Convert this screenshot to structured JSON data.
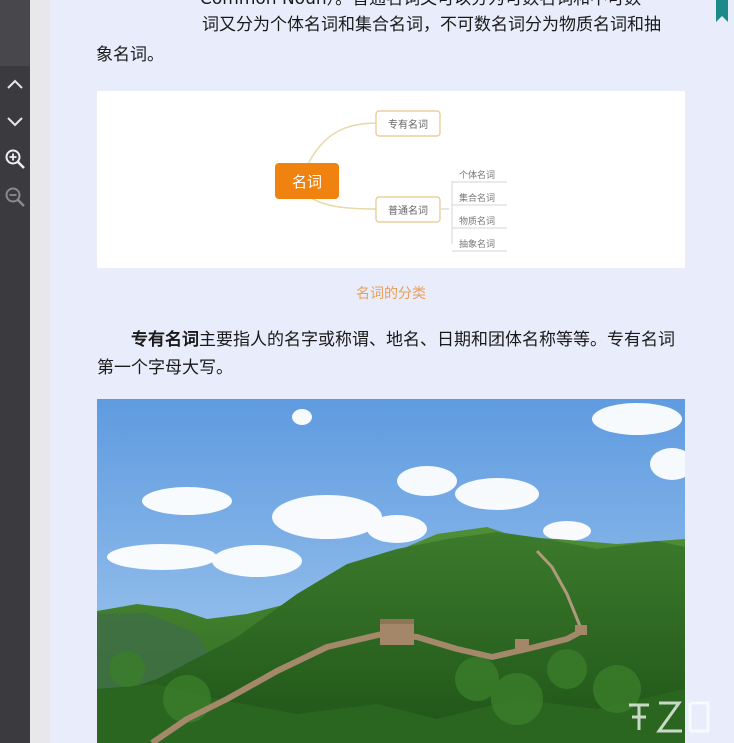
{
  "toolbar": {
    "buttons": [
      {
        "icon": "chevron-up-icon"
      },
      {
        "icon": "chevron-down-icon"
      },
      {
        "icon": "zoom-in-icon"
      },
      {
        "icon": "zoom-out-icon"
      }
    ]
  },
  "article": {
    "cut_line": "Common Noun）。普通名词又可以分为可数名词和不可数",
    "line1": "词又分为个体名词和集合名词，不可数名词分为物质名词和抽",
    "line2": "象名词。",
    "mindmap": {
      "root": "名词",
      "branch1": "专有名词",
      "branch2": "普通名词",
      "leaves": [
        "个体名词",
        "集合名词",
        "物质名词",
        "抽象名词"
      ]
    },
    "caption": "名词的分类",
    "para2_bold": "专有名词",
    "para2_rest": "主要指人的名字或称谓、地名、日期和团体名称等等。专有名词第一个字母大写。"
  },
  "colors": {
    "page_bg": "#e9ecfb",
    "toolbar_bg": "#3a3a3f",
    "accent_orange": "#f0820f",
    "caption": "#e8a05a",
    "bookmark": "#1d8a8a"
  }
}
